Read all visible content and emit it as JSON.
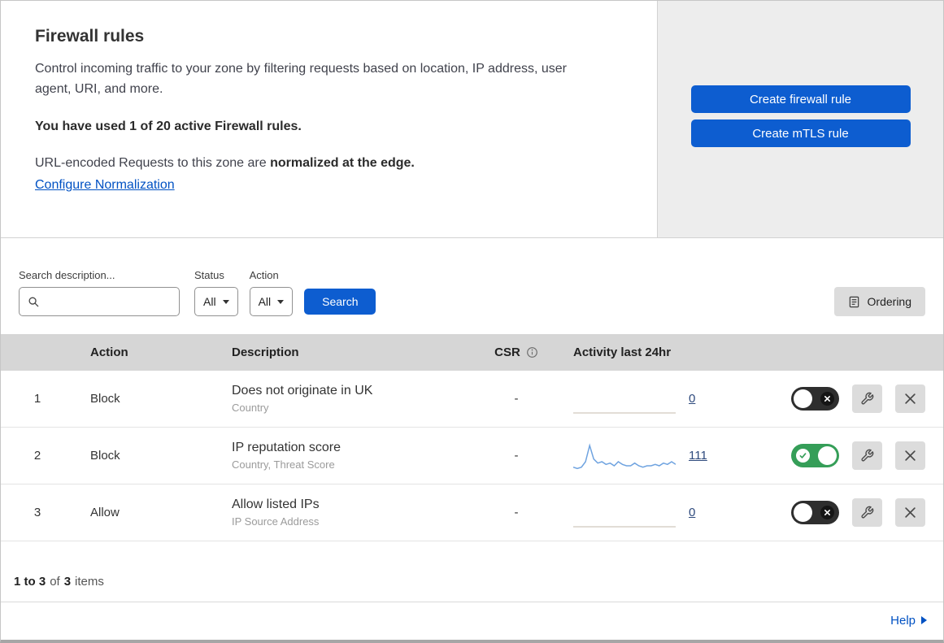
{
  "colors": {
    "primary_blue": "#0d5dd0",
    "link_blue": "#0051c3",
    "toggle_on_green": "#359e58",
    "sparkline_blue": "#6fa3e0",
    "flatline_gray": "#d8d2c8",
    "count_link_blue": "#2e4a7d"
  },
  "intro": {
    "title": "Firewall rules",
    "description": "Control incoming traffic to your zone by filtering requests based on location, IP address, user agent, URI, and more.",
    "usage": "You have used 1 of 20 active Firewall rules.",
    "normalization_prefix": "URL-encoded Requests to this zone are ",
    "normalization_bold": "normalized at the edge.",
    "normalization_link": "Configure Normalization"
  },
  "cta": {
    "create_firewall_rule": "Create firewall rule",
    "create_mtls_rule": "Create mTLS rule"
  },
  "filters": {
    "search_label": "Search description...",
    "status_label": "Status",
    "status_value": "All",
    "action_label": "Action",
    "action_value": "All",
    "search_button": "Search",
    "ordering_button": "Ordering"
  },
  "table": {
    "header": {
      "action": "Action",
      "description": "Description",
      "csr": "CSR",
      "activity": "Activity last 24hr"
    },
    "rows": [
      {
        "num": "1",
        "action": "Block",
        "description": "Does not originate in UK",
        "subtitle": "Country",
        "csr": "-",
        "count": "0",
        "enabled": false,
        "sparkline": [
          0,
          0
        ]
      },
      {
        "num": "2",
        "action": "Block",
        "description": "IP reputation score",
        "subtitle": "Country, Threat Score",
        "csr": "-",
        "count": "111",
        "enabled": true,
        "sparkline": [
          2,
          1,
          2,
          6,
          18,
          8,
          5,
          6,
          4,
          5,
          3,
          6,
          4,
          3,
          3,
          5,
          3,
          2,
          3,
          3,
          4,
          3,
          5,
          4,
          6,
          4
        ]
      },
      {
        "num": "3",
        "action": "Allow",
        "description": "Allow listed IPs",
        "subtitle": "IP Source Address",
        "csr": "-",
        "count": "0",
        "enabled": false,
        "sparkline": [
          0,
          0
        ]
      }
    ]
  },
  "summary": {
    "range": "1 to 3",
    "of_text": "of",
    "total": "3",
    "items_text": "items"
  },
  "help": {
    "label": "Help"
  }
}
